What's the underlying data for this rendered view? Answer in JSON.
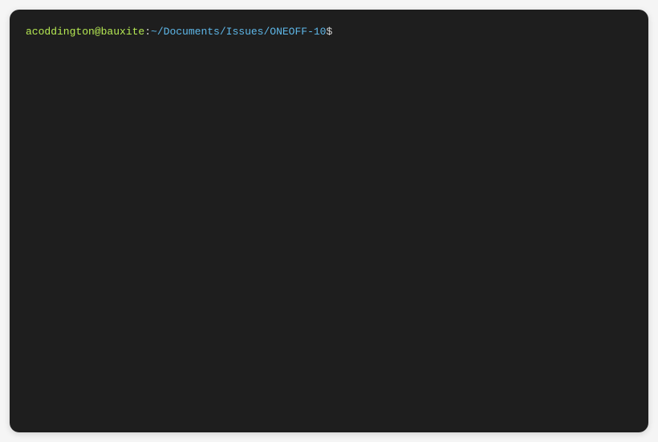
{
  "terminal": {
    "prompt": {
      "user_host": "acoddington@bauxite",
      "separator": ":",
      "path": "~/Documents/Issues/ONEOFF-10",
      "symbol": "$"
    },
    "command": ""
  },
  "colors": {
    "background": "#1e1e1e",
    "user_host": "#b5e853",
    "separator": "#d4d4d4",
    "path": "#5eb7e8",
    "symbol": "#d4d4d4",
    "text": "#d4d4d4"
  }
}
